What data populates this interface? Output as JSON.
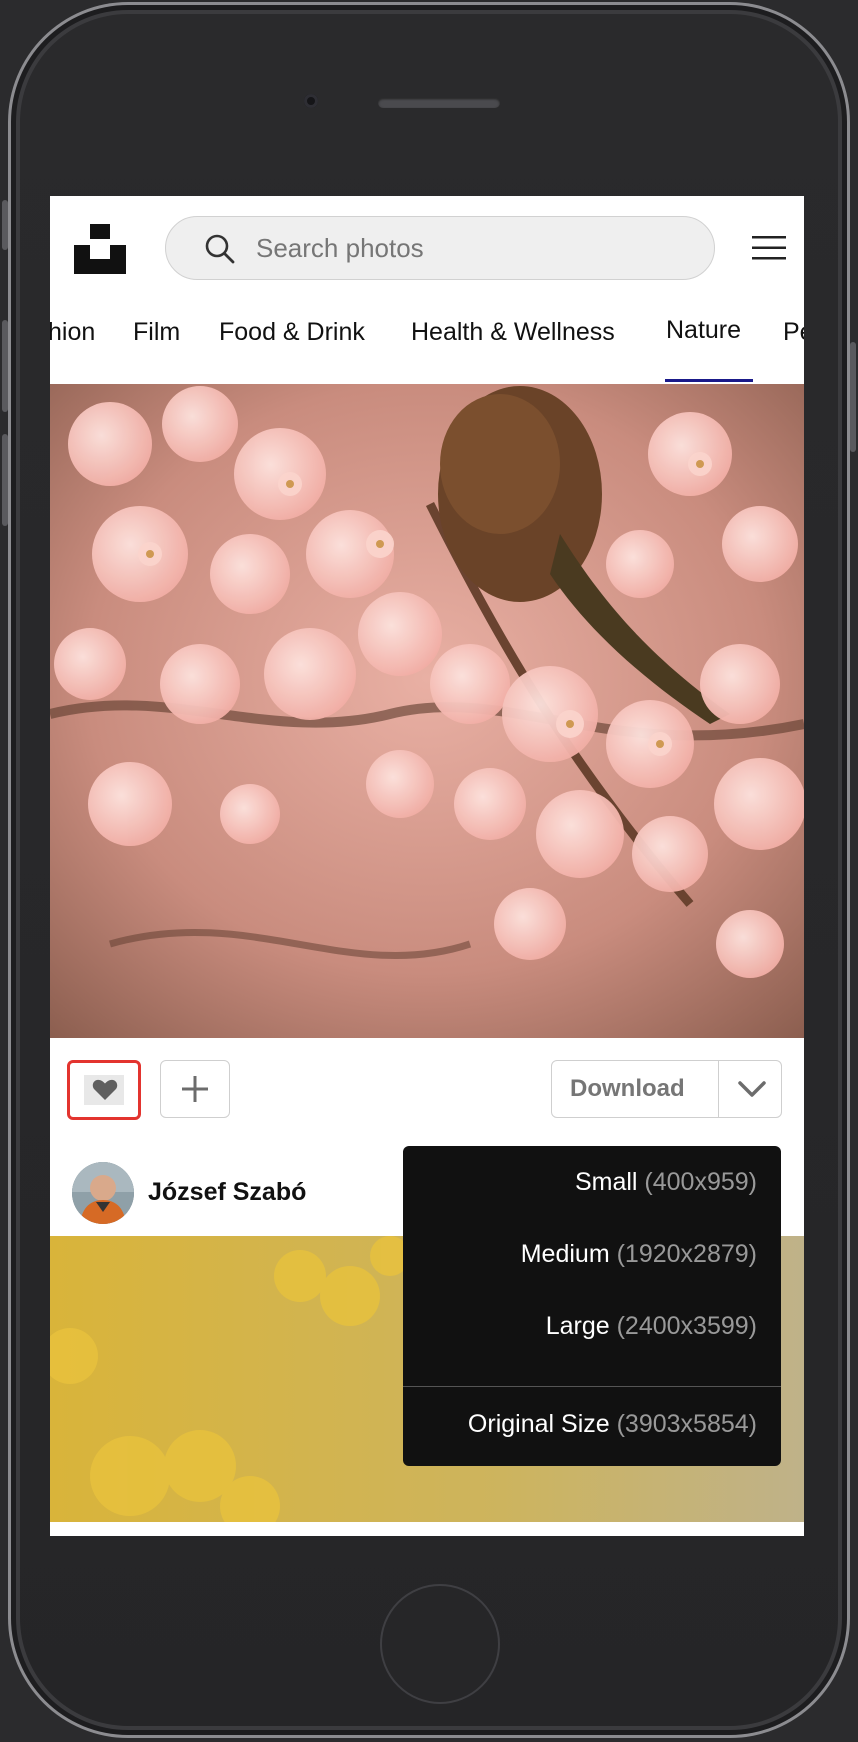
{
  "search": {
    "placeholder": "Search photos"
  },
  "tabs": [
    {
      "label": "hion"
    },
    {
      "label": "Film"
    },
    {
      "label": "Food & Drink"
    },
    {
      "label": "Health & Wellness"
    },
    {
      "label": "Nature",
      "active": true
    },
    {
      "label": "Pe"
    }
  ],
  "actions": {
    "download_label": "Download"
  },
  "author": {
    "name": "József Szabó"
  },
  "download_menu": [
    {
      "size": "Small",
      "dims": "(400x959)"
    },
    {
      "size": "Medium",
      "dims": "(1920x2879)"
    },
    {
      "size": "Large",
      "dims": "(2400x3599)"
    },
    {
      "size": "Original Size",
      "dims": "(3903x5854)"
    }
  ],
  "colors": {
    "highlight": "#e3342f",
    "tab_underline": "#1a1a8a",
    "menu_bg": "#111111"
  }
}
